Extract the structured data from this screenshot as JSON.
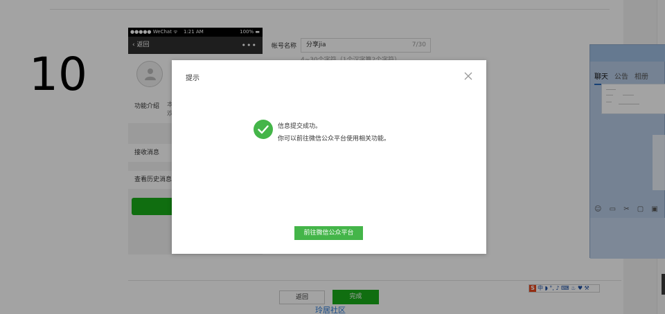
{
  "step_number": "10",
  "phone": {
    "status_carrier": "●●●●● WeChat ᯤ",
    "status_time": "1:21 AM",
    "status_battery": "100% ▬",
    "nav_back": "返回",
    "nav_more": "•••",
    "intro_label": "功能介绍",
    "intro_text": "本 欢",
    "row_receive": "接收消息",
    "row_history": "查看历史消息"
  },
  "form": {
    "name_label": "帐号名称",
    "name_value": "分享jia",
    "name_count": "7/30",
    "name_hint": "4~30个字符（1个汉字算2个字符）"
  },
  "footer": {
    "back_label": "返回",
    "done_label": "完成",
    "watermark": "玲居社区"
  },
  "chat": {
    "tabs": [
      "聊天",
      "公告",
      "相册"
    ],
    "tools": "☺ ▭ ✂ ▢ ▣"
  },
  "ime": {
    "logo": "S",
    "items": "中 ◗ °, ♪ ⌨ ♨ ♥ ⚒"
  },
  "dialog": {
    "title": "提示",
    "close_icon": "close-icon",
    "message_line1": "信息提交成功。",
    "message_line2": "你可以前往微信公众平台使用相关功能。",
    "button_label": "前往微信公众平台",
    "accent_color": "#44b549"
  }
}
